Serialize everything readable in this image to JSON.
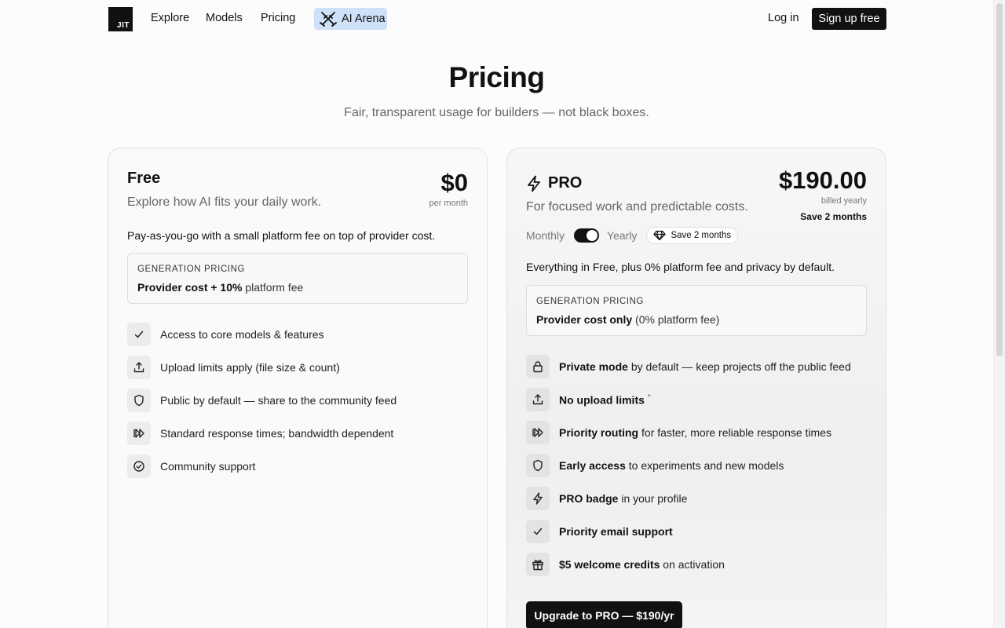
{
  "nav": {
    "logo": "JIT",
    "links": [
      "Explore",
      "Models",
      "Pricing"
    ],
    "arena": "AI Arena",
    "login": "Log in",
    "signup": "Sign up free"
  },
  "hero": {
    "title": "Pricing",
    "subtitle": "Fair, transparent usage for builders — not black boxes."
  },
  "free": {
    "name": "Free",
    "desc": "Explore how AI fits your daily work.",
    "price": "$0",
    "price_note": "per month",
    "intro": "Pay-as-you-go with a small platform fee on top of provider cost.",
    "gen_label": "GENERATION PRICING",
    "gen_bold": "Provider cost + 10%",
    "gen_rest": " platform fee",
    "features": [
      {
        "icon": "check-icon",
        "text": "Access to core models & features"
      },
      {
        "icon": "upload-icon",
        "text": "Upload limits apply (file size & count)"
      },
      {
        "icon": "shield-icon",
        "text": "Public by default — share to the community feed"
      },
      {
        "icon": "fast-forward-icon",
        "text": "Standard response times; bandwidth dependent"
      },
      {
        "icon": "check-circle-icon",
        "text": "Community support"
      }
    ]
  },
  "pro": {
    "name": "PRO",
    "desc": "For focused work and predictable costs.",
    "price": "$190.00",
    "price_note": "billed yearly",
    "save_note": "Save 2 months",
    "toggle_monthly": "Monthly",
    "toggle_yearly": "Yearly",
    "toggle_state": "Yearly",
    "save_pill": "Save 2 months",
    "intro": "Everything in Free, plus 0% platform fee and privacy by default.",
    "gen_label": "GENERATION PRICING",
    "gen_bold": "Provider cost only",
    "gen_rest": " (0% platform fee)",
    "features": [
      {
        "icon": "lock-icon",
        "bold": "Private mode",
        "rest": " by default — keep projects off the public feed"
      },
      {
        "icon": "upload-icon",
        "bold": "No upload limits",
        "rest": "",
        "sup": "*"
      },
      {
        "icon": "fast-forward-icon",
        "bold": "Priority routing",
        "rest": " for faster, more reliable response times"
      },
      {
        "icon": "shield-icon",
        "bold": "Early access",
        "rest": " to experiments and new models"
      },
      {
        "icon": "bolt-icon",
        "bold": "PRO badge",
        "rest": " in your profile"
      },
      {
        "icon": "check-icon",
        "bold": "Priority email support",
        "rest": ""
      },
      {
        "icon": "gift-icon",
        "bold": "$5 welcome credits",
        "rest": " on activation"
      }
    ],
    "upgrade": "Upgrade to PRO — $190/yr"
  }
}
